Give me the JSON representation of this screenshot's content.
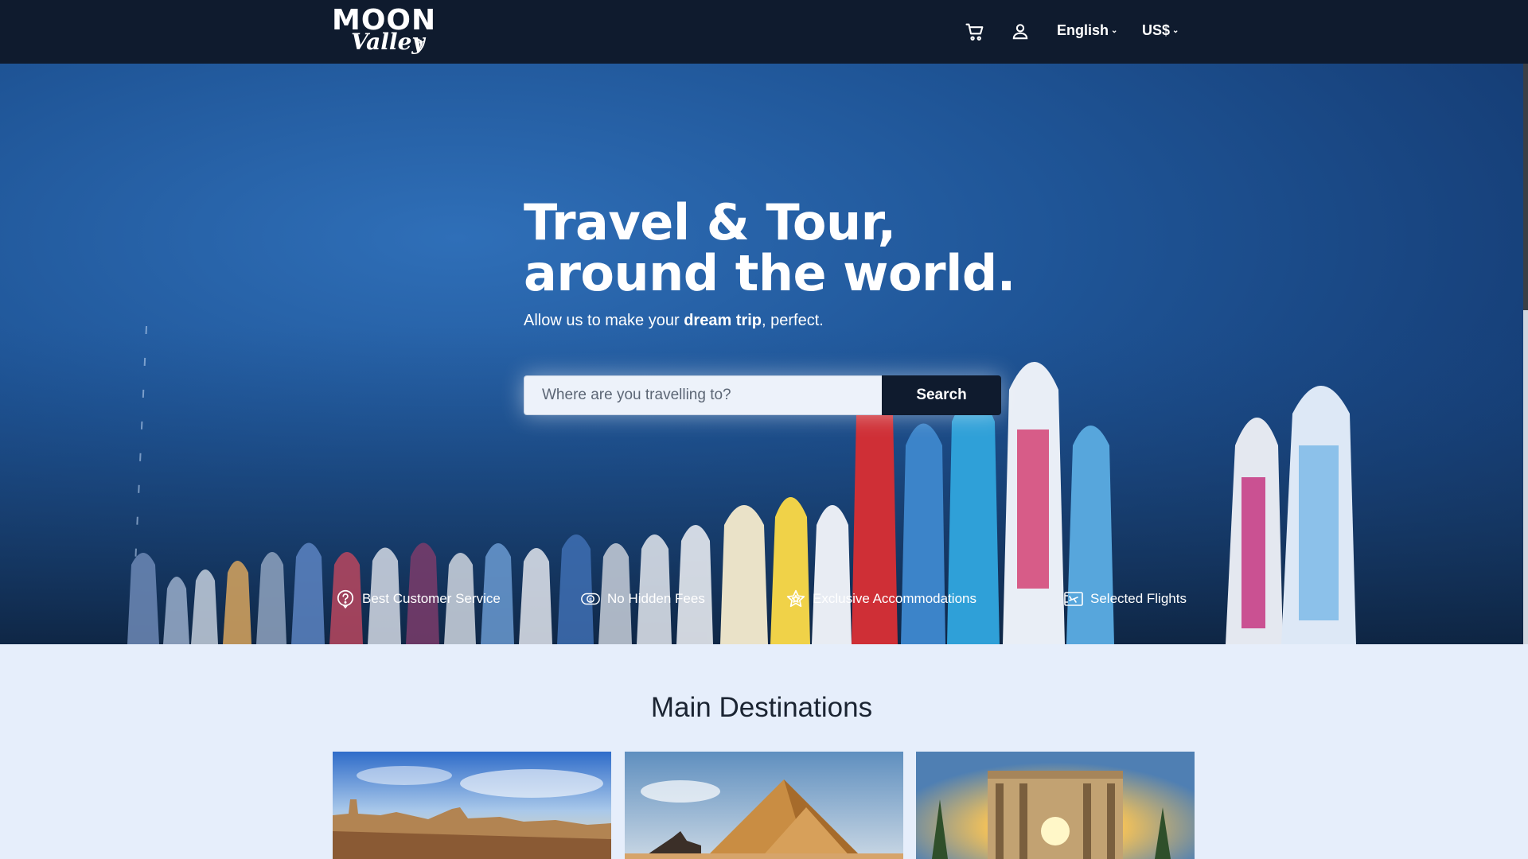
{
  "header": {
    "logo_text_top": "MOON",
    "logo_text_bottom": "Valley",
    "cart_icon": "cart-icon",
    "account_icon": "user-icon",
    "language": "English",
    "currency": "US$"
  },
  "hero": {
    "title_line1": "Travel & Tour,",
    "title_line2": "around the world.",
    "subtitle_pre": "Allow us to make your ",
    "subtitle_bold": "dream trip",
    "subtitle_post": ", perfect.",
    "search_placeholder": "Where are you travelling to?",
    "search_button": "Search"
  },
  "features": [
    {
      "icon": "question-circle-icon",
      "label": "Best Customer Service"
    },
    {
      "icon": "money-icon",
      "label": "No Hidden Fees"
    },
    {
      "icon": "star-icon",
      "label": "Exclusive Accommodations"
    },
    {
      "icon": "ticket-icon",
      "label": "Selected Flights"
    }
  ],
  "destinations": {
    "title": "Main Destinations",
    "cards": [
      {
        "image": "city-skyline-image"
      },
      {
        "image": "pyramids-image"
      },
      {
        "image": "ancient-library-image"
      }
    ]
  },
  "colors": {
    "navbar": "#0f1b2e",
    "hero_blue": "#1f5597",
    "page_bg": "#e6eefb",
    "button_dark": "#0f1b2e"
  }
}
